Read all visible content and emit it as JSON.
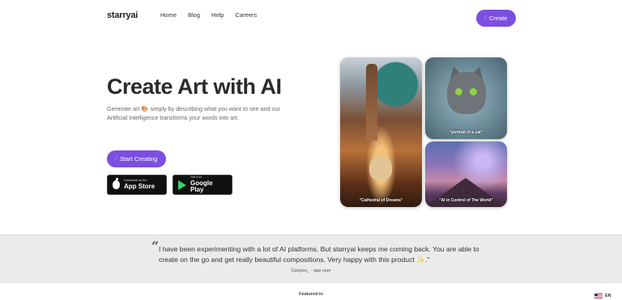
{
  "nav": {
    "logo": "starryai",
    "links": [
      "Home",
      "Blog",
      "Help",
      "Careers"
    ],
    "create_label": "Create"
  },
  "hero": {
    "headline": "Create Art with AI",
    "subtext_part1": "Generate art",
    "subtext_part2": "simply by describing what you want to see and our Artificial Intelligence transforms your words into art.",
    "start_label": "Start Creating",
    "app_store_small": "Download on the",
    "app_store_big": "App Store",
    "google_play_small": "Get it on",
    "google_play_big": "Google Play"
  },
  "gallery": {
    "captions": [
      "\"Cathedral of Dreams\"",
      "\"portrait of a cat\"",
      "\"AI in Control of The World\""
    ]
  },
  "testimonial": {
    "quote": "I have been experimenting with a lot of AI platforms. But starryai keeps me coming back. You are able to create on the go and get really beautiful compositions. Very happy with this product ✨.\"",
    "author": "Calypso_ - app user"
  },
  "footer": {
    "featured_label": "Featured in",
    "language": "EN"
  },
  "colors": {
    "accent": "#7c4fe0",
    "testimonial_bg": "#ebebeb"
  },
  "icons": [
    "magic-wand-icon",
    "apple-icon",
    "google-play-icon",
    "palette-emoji",
    "sparkles-emoji",
    "us-flag-icon"
  ]
}
